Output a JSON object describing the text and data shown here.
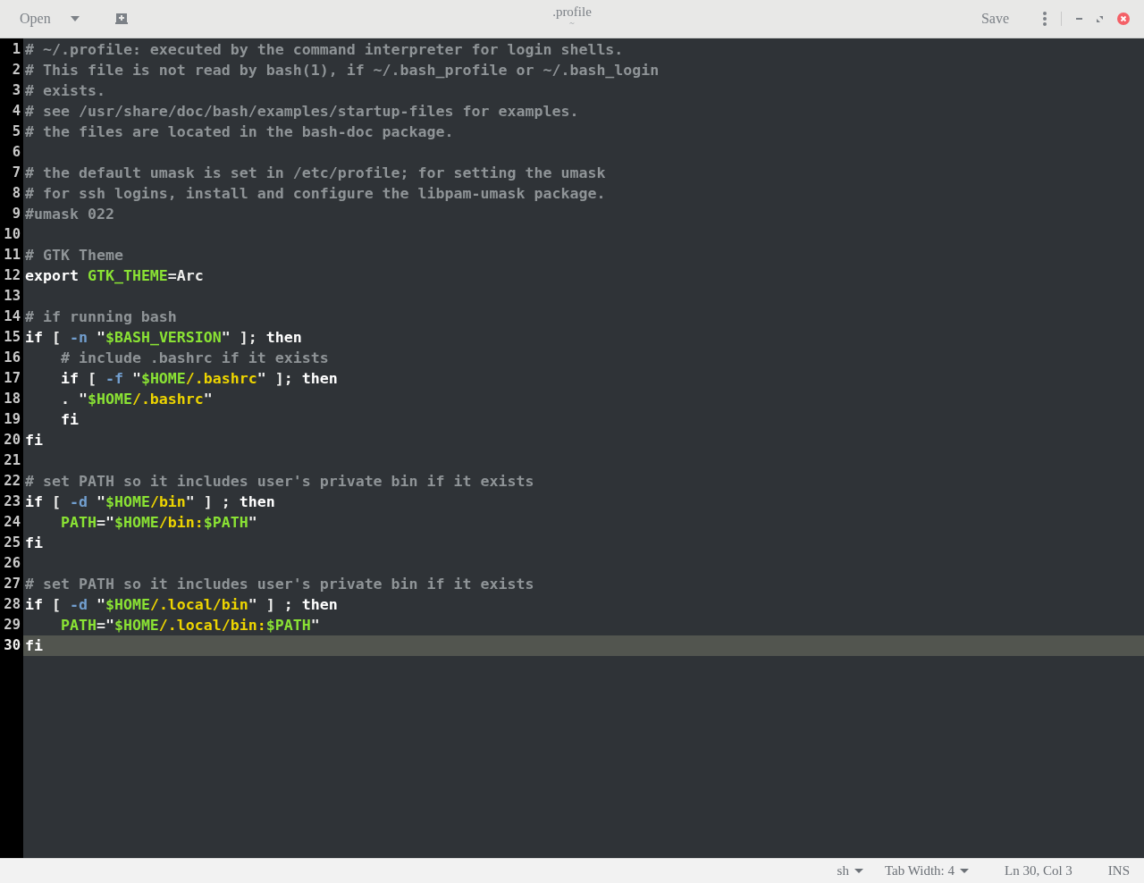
{
  "header": {
    "open_label": "Open",
    "title": ".profile",
    "subtitle": "~",
    "save_label": "Save"
  },
  "lines": [
    {
      "number": "1",
      "current": false,
      "tokens": [
        {
          "kind": "comment",
          "text": "# ~/.profile: executed by the command interpreter for login shells."
        }
      ]
    },
    {
      "number": "2",
      "current": false,
      "tokens": [
        {
          "kind": "comment",
          "text": "# This file is not read by bash(1), if ~/.bash_profile or ~/.bash_login"
        }
      ]
    },
    {
      "number": "3",
      "current": false,
      "tokens": [
        {
          "kind": "comment",
          "text": "# exists."
        }
      ]
    },
    {
      "number": "4",
      "current": false,
      "tokens": [
        {
          "kind": "comment",
          "text": "# see /usr/share/doc/bash/examples/startup-files for examples."
        }
      ]
    },
    {
      "number": "5",
      "current": false,
      "tokens": [
        {
          "kind": "comment",
          "text": "# the files are located in the bash-doc package."
        }
      ]
    },
    {
      "number": "6",
      "current": false
    },
    {
      "number": "7",
      "current": false,
      "tokens": [
        {
          "kind": "comment",
          "text": "# the default umask is set in /etc/profile; for setting the umask"
        }
      ]
    },
    {
      "number": "8",
      "current": false,
      "tokens": [
        {
          "kind": "comment",
          "text": "# for ssh logins, install and configure the libpam-umask package."
        }
      ]
    },
    {
      "number": "9",
      "current": false,
      "tokens": [
        {
          "kind": "comment",
          "text": "#umask 022"
        }
      ]
    },
    {
      "number": "10",
      "current": false
    },
    {
      "number": "11",
      "current": false,
      "tokens": [
        {
          "kind": "comment",
          "text": "# GTK Theme"
        }
      ]
    },
    {
      "number": "12",
      "current": false,
      "tokens": [
        {
          "kind": "keyword",
          "text": "export "
        },
        {
          "kind": "variable",
          "text": "GTK_THEME"
        },
        {
          "kind": "plain",
          "text": "=Arc"
        }
      ]
    },
    {
      "number": "13",
      "current": false
    },
    {
      "number": "14",
      "current": false,
      "tokens": [
        {
          "kind": "comment",
          "text": "# if running bash"
        }
      ]
    },
    {
      "number": "15",
      "current": false,
      "tokens": [
        {
          "kind": "keyword",
          "text": "if"
        },
        {
          "kind": "plain",
          "text": " [ "
        },
        {
          "kind": "option",
          "text": "-n"
        },
        {
          "kind": "plain",
          "text": " \""
        },
        {
          "kind": "variable",
          "text": "$BASH_VERSION"
        },
        {
          "kind": "plain",
          "text": "\" ]; "
        },
        {
          "kind": "keyword",
          "text": "then"
        }
      ]
    },
    {
      "number": "16",
      "current": false,
      "indented": true,
      "tokens": [
        {
          "kind": "comment",
          "text": "# include .bashrc if it exists"
        }
      ]
    },
    {
      "number": "17",
      "current": false,
      "indented": true,
      "tokens": [
        {
          "kind": "keyword",
          "text": "if"
        },
        {
          "kind": "plain",
          "text": " [ "
        },
        {
          "kind": "option",
          "text": "-f"
        },
        {
          "kind": "plain",
          "text": " \""
        },
        {
          "kind": "variable",
          "text": "$HOME"
        },
        {
          "kind": "string",
          "text": "/.bashrc"
        },
        {
          "kind": "plain",
          "text": "\" ]; "
        },
        {
          "kind": "keyword",
          "text": "then"
        }
      ]
    },
    {
      "number": "18",
      "current": false,
      "indented": true,
      "tokens": [
        {
          "kind": "plain",
          "text": ". \""
        },
        {
          "kind": "variable",
          "text": "$HOME"
        },
        {
          "kind": "string",
          "text": "/.bashrc"
        },
        {
          "kind": "plain",
          "text": "\""
        }
      ]
    },
    {
      "number": "19",
      "current": false,
      "indented": true,
      "tokens": [
        {
          "kind": "keyword",
          "text": "fi"
        }
      ]
    },
    {
      "number": "20",
      "current": false,
      "tokens": [
        {
          "kind": "keyword",
          "text": "fi"
        }
      ]
    },
    {
      "number": "21",
      "current": false
    },
    {
      "number": "22",
      "current": false,
      "tokens": [
        {
          "kind": "comment",
          "text": "# set PATH so it includes user's private bin if it exists"
        }
      ]
    },
    {
      "number": "23",
      "current": false,
      "tokens": [
        {
          "kind": "keyword",
          "text": "if"
        },
        {
          "kind": "plain",
          "text": " [ "
        },
        {
          "kind": "option",
          "text": "-d"
        },
        {
          "kind": "plain",
          "text": " \""
        },
        {
          "kind": "variable",
          "text": "$HOME"
        },
        {
          "kind": "string",
          "text": "/bin"
        },
        {
          "kind": "plain",
          "text": "\" ] ; "
        },
        {
          "kind": "keyword",
          "text": "then"
        }
      ]
    },
    {
      "number": "24",
      "current": false,
      "indented": true,
      "tokens": [
        {
          "kind": "variable",
          "text": "PATH"
        },
        {
          "kind": "plain",
          "text": "=\""
        },
        {
          "kind": "variable",
          "text": "$HOME"
        },
        {
          "kind": "string",
          "text": "/bin:"
        },
        {
          "kind": "variable",
          "text": "$PATH"
        },
        {
          "kind": "plain",
          "text": "\""
        }
      ]
    },
    {
      "number": "25",
      "current": false,
      "tokens": [
        {
          "kind": "keyword",
          "text": "fi"
        }
      ]
    },
    {
      "number": "26",
      "current": false
    },
    {
      "number": "27",
      "current": false,
      "tokens": [
        {
          "kind": "comment",
          "text": "# set PATH so it includes user's private bin if it exists"
        }
      ]
    },
    {
      "number": "28",
      "current": false,
      "tokens": [
        {
          "kind": "keyword",
          "text": "if"
        },
        {
          "kind": "plain",
          "text": " [ "
        },
        {
          "kind": "option",
          "text": "-d"
        },
        {
          "kind": "plain",
          "text": " \""
        },
        {
          "kind": "variable",
          "text": "$HOME"
        },
        {
          "kind": "string",
          "text": "/.local/bin"
        },
        {
          "kind": "plain",
          "text": "\" ] ; "
        },
        {
          "kind": "keyword",
          "text": "then"
        }
      ]
    },
    {
      "number": "29",
      "current": false,
      "indented": true,
      "tokens": [
        {
          "kind": "variable",
          "text": "PATH"
        },
        {
          "kind": "plain",
          "text": "=\""
        },
        {
          "kind": "variable",
          "text": "$HOME"
        },
        {
          "kind": "string",
          "text": "/.local/bin:"
        },
        {
          "kind": "variable",
          "text": "$PATH"
        },
        {
          "kind": "plain",
          "text": "\""
        }
      ]
    },
    {
      "number": "30",
      "current": true,
      "tokens": [
        {
          "kind": "keyword",
          "text": "fi"
        }
      ]
    }
  ],
  "status_bar": {
    "language": "sh",
    "tab_width": "Tab Width: 4",
    "position": "Ln 30, Col 3",
    "mode": "INS"
  }
}
